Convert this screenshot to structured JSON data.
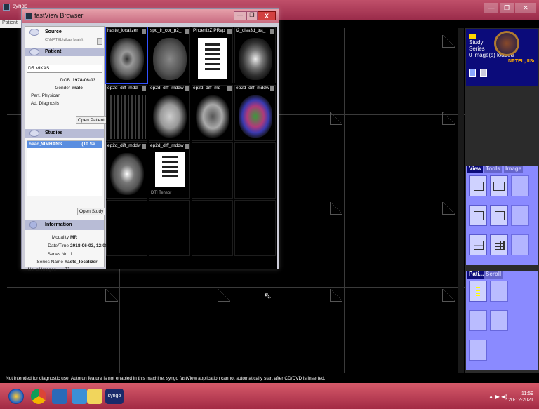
{
  "app": {
    "title": "syngo",
    "menu": "Patient",
    "win_min": "—",
    "win_max": "❐",
    "win_close": "✕"
  },
  "status_bar": {
    "text": "Not intended for diagnostic use.      Autorun feature is not enabled in this machine. syngo fastView application cannot automatically start after CD/DVD is inserted."
  },
  "taskbar": {
    "clock_time": "11:59",
    "clock_date": "20-12-2021",
    "tray": "▲ ▶ ◀)",
    "icons": [
      "windows-start-icon",
      "chrome-icon",
      "file-explorer-icon",
      "documents-icon",
      "file-manager-icon",
      "syngo-app-icon"
    ],
    "syngo_label": "syngo"
  },
  "study_panel": {
    "lines": [
      "Study",
      "Series",
      "0 image(s) loaded"
    ],
    "logo_text": "NPTEL, IISc"
  },
  "view_panel": {
    "tabs": [
      "View",
      "Tools",
      "Image"
    ]
  },
  "patient_panel": {
    "tabs": [
      "Pati...",
      "Scroll"
    ]
  },
  "fastview": {
    "title": "fastView Browser",
    "close": "X",
    "source": {
      "header": "Source",
      "path": "C:\\NPTEL\\vikas brain\\"
    },
    "patient": {
      "header": "Patient",
      "name": "DR VIKAS",
      "dob_label": "DOB",
      "dob": "1978-06-03",
      "gender_label": "Gender",
      "gender": "male",
      "physician_label": "Perf. Physican",
      "diagnosis_label": "Ad. Diagnosis",
      "open_button": "Open Patient"
    },
    "studies": {
      "header": "Studies",
      "row_name": "head,NIMHANS",
      "row_count": "(10 Se...",
      "open_button": "Open Study"
    },
    "information": {
      "header": "Information",
      "modality_label": "Modality",
      "modality": "MR",
      "datetime_label": "Date/Time",
      "datetime": "2018-06-03, 12:08 h",
      "series_no_label": "Series No.",
      "series_no": "1",
      "series_name_label": "Series Name",
      "series_name": "haste_localizer",
      "num_images_label": "No. of Images",
      "num_images": "11"
    },
    "series": [
      {
        "label": "haste_localizer"
      },
      {
        "label": "spc_ir_cor_p2_"
      },
      {
        "label": "PhoenixZIPRep"
      },
      {
        "label": "t2_ciss3d_tra_"
      },
      {
        "label": "ep2d_diff_mdd"
      },
      {
        "label": "ep2d_diff_mddw"
      },
      {
        "label": "ep2d_diff_md"
      },
      {
        "label": "ep2d_diff_mddw"
      },
      {
        "label": "ep2d_diff_mddw"
      },
      {
        "label": "ep2d_diff_mddw"
      }
    ],
    "dti_label": "DTI Tensor"
  }
}
